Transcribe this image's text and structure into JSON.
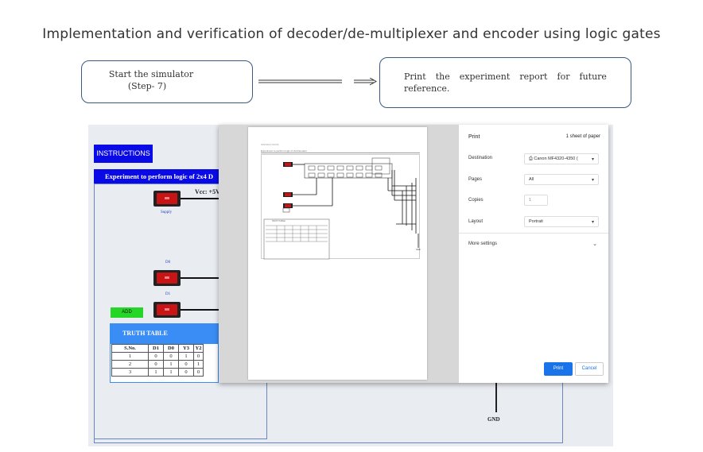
{
  "title": "Implementation and verification of decoder/de-multiplexer and encoder using logic gates",
  "step": {
    "line1": "Start the simulator",
    "line2": "(Step- 7)"
  },
  "report": {
    "words": [
      "Print",
      "the",
      "experiment",
      "report",
      "for",
      "future"
    ],
    "line2": "reference."
  },
  "simulator": {
    "instructions_label": "INSTRUCTIONS",
    "experiment_header": "Experiment to perform logic of 2x4 D",
    "vcc_label": "Vcc: +5V",
    "supply_label": "Supply",
    "d0_label": "D0",
    "d1_label": "D1",
    "add_label": "ADD",
    "truth_table": {
      "title": "TRUTH TABLE",
      "headers": [
        "S.No.",
        "D1",
        "D0",
        "Y3",
        "Y2"
      ],
      "rows": [
        [
          "1",
          "0",
          "0",
          "1",
          "0"
        ],
        [
          "2",
          "0",
          "1",
          "0",
          "1"
        ],
        [
          "3",
          "1",
          "1",
          "0",
          "0"
        ]
      ]
    },
    "gnd_label": "GND"
  },
  "print_dialog": {
    "title": "Print",
    "sheet_count": "1 sheet of paper",
    "destination_label": "Destination",
    "destination_value": "Canon MF4320-4350 (",
    "pages_label": "Pages",
    "pages_value": "All",
    "copies_label": "Copies",
    "copies_value": "1",
    "layout_label": "Layout",
    "layout_value": "Portrait",
    "more_settings": "More settings",
    "print_button": "Print",
    "cancel_button": "Cancel",
    "preview_header": "INSTRUCTIONS",
    "preview_subtitle": "Experiment to perform logic of 2x4 Decoder",
    "preview_table_title": "TRUTH TABLE",
    "preview_gnd": "GND"
  },
  "colors": {
    "accent_blue": "#0a0ae6",
    "switch_red": "#c81414",
    "add_green": "#26d626",
    "print_blue": "#1a73e8"
  }
}
